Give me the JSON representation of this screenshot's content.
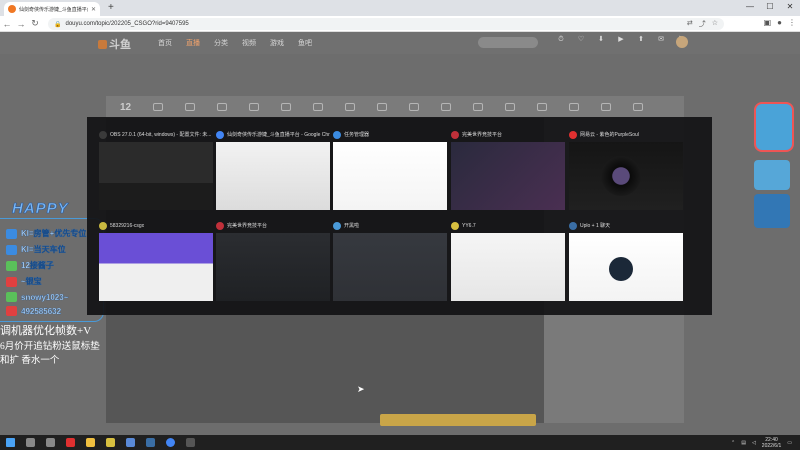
{
  "browser": {
    "tab_title": "仙剑奇侠传乐游婕_斗鱼直播平台",
    "url": "douyu.com/topic/202205_CSGO?rid=9407595",
    "new_tab": "+",
    "nav": {
      "back": "←",
      "forward": "→",
      "reload": "↻"
    },
    "window": {
      "minimize": "—",
      "maximize": "☐",
      "close": "✕"
    }
  },
  "site": {
    "logo": "斗鱼",
    "nav": [
      "首页",
      "直播",
      "分类",
      "视频",
      "游戏",
      "鱼吧"
    ],
    "search_placeholder": "",
    "icons": [
      {
        "icon": "history-icon",
        "label": ""
      },
      {
        "icon": "follow-icon",
        "label": ""
      },
      {
        "icon": "download-icon",
        "label": ""
      },
      {
        "icon": "live-icon",
        "label": ""
      },
      {
        "icon": "upload-icon",
        "label": ""
      },
      {
        "icon": "message-icon",
        "label": ""
      },
      {
        "icon": "task-icon",
        "label": ""
      }
    ],
    "new_badge": "",
    "ribbon_number": "12",
    "side_link": "",
    "under_video_text": "",
    "gift_bar": ""
  },
  "overlay": {
    "title": "HAPPY",
    "rows": [
      {
        "text": "Kl=房管+优先专位",
        "color": "#3b8be0"
      },
      {
        "text": "Kl=当天车位",
        "color": "#3b8be0"
      },
      {
        "text": "12接酱子",
        "color": "#5ac05a"
      },
      {
        "text": "~银宝",
        "color": "#e04040"
      },
      {
        "text": "snowy1023~",
        "color": "#5ac05a"
      },
      {
        "text": "492585632",
        "color": "#e04040"
      }
    ],
    "line1": "调机器优化帧数+V",
    "line2": "6月价开追钻粉送鼠标垫",
    "line3": "和扩 香水一个"
  },
  "switcher": {
    "windows": [
      {
        "label": "OBS 27.0.1 (64-bit, windows) - 配置文件: 未...",
        "color": "#3a3a3a"
      },
      {
        "label": "仙剑奇侠传乐游婕_斗鱼直播平台 - Google Chr...",
        "color": "#4285f4"
      },
      {
        "label": "任务管理器",
        "color": "#3b8be0"
      },
      {
        "label": "完美世界竞技平台",
        "color": "#c0303a"
      },
      {
        "label": "网易云 - 紫色的PurpleSoul",
        "color": "#e03030"
      },
      {
        "label": "58329216-csgo",
        "color": "#c8b840"
      },
      {
        "label": "完美世界竞技平台",
        "color": "#c0303a"
      },
      {
        "label": "开黑啦",
        "color": "#4a9ad8"
      },
      {
        "label": "YY6.7",
        "color": "#d8c040"
      },
      {
        "label": "Uplo + 1 聊天",
        "color": "#3a6ea5"
      }
    ]
  },
  "taskbar": {
    "apps": [
      {
        "icon": "windows-start-icon",
        "color": "#4aa3f5"
      },
      {
        "icon": "search-icon",
        "color": "#888888"
      },
      {
        "icon": "taskview-icon",
        "color": "#888888"
      },
      {
        "icon": "netease-music-icon",
        "color": "#e03030"
      },
      {
        "icon": "folder-icon",
        "color": "#f0c040"
      },
      {
        "icon": "yy-icon",
        "color": "#d8c040"
      },
      {
        "icon": "kaiheila-icon",
        "color": "#5a8ad8"
      },
      {
        "icon": "steam-icon",
        "color": "#3a6ea5"
      },
      {
        "icon": "chrome-icon",
        "color": "#4285f4"
      },
      {
        "icon": "obs-icon",
        "color": "#555555"
      }
    ],
    "time": "22:40",
    "date": "2022/6/1"
  }
}
